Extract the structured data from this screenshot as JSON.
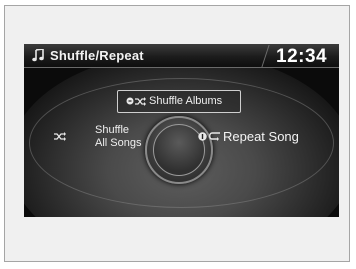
{
  "header": {
    "icon": "music-note-icon",
    "title": "Shuffle/Repeat",
    "clock": "12:34"
  },
  "options": {
    "shuffle_albums": {
      "label": "Shuffle  Albums",
      "icons": [
        "off-indicator-icon",
        "shuffle-icon"
      ]
    },
    "shuffle_all_songs": {
      "label_line1": "Shuffle",
      "label_line2": "All Songs",
      "icon": "shuffle-icon"
    },
    "repeat_song": {
      "label": "Repeat Song",
      "icons": [
        "one-indicator-icon",
        "repeat-icon"
      ]
    }
  },
  "colors": {
    "screen_bg": "#0b0b0b",
    "text": "#f0f0f0",
    "frame_bg": "#f0f0f0"
  }
}
